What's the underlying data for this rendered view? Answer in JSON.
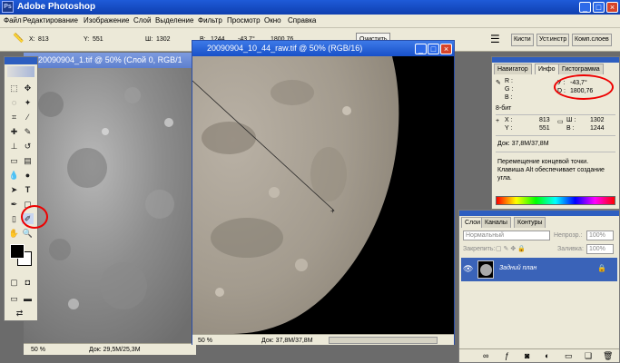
{
  "app": {
    "title": "Adobe Photoshop"
  },
  "window_controls": {
    "minimize": "_",
    "maximize": "□",
    "close": "×"
  },
  "menu": [
    "Файл",
    "Редактирование",
    "Изображение",
    "Слой",
    "Выделение",
    "Фильтр",
    "Просмотр",
    "Окно",
    "Справка"
  ],
  "options_bar": {
    "x_label": "X:",
    "x_value": "813",
    "y_label": "Y:",
    "y_value": "551",
    "w_label": "Ш:",
    "w_value": "1302",
    "h_label": "В:",
    "h_value": "1244",
    "angle_value": "-43,7°",
    "dist_value": "1800,76",
    "clear_button": "Очистить",
    "palette_tabs": [
      "Кисти",
      "Уст.инстр",
      "Комп.слоев"
    ]
  },
  "doc1": {
    "title": "20090904_1.tif @ 50% (Слой 0, RGB/1",
    "zoom": "50 %",
    "status": "Док: 29,5M/25,3M"
  },
  "doc2": {
    "title": "20090904_10_44_raw.tif @ 50% (RGB/16)",
    "zoom": "50 %",
    "status": "Док: 37,8M/37,8M"
  },
  "info_panel": {
    "tabs": [
      "Навигатор",
      "Инфо",
      "Гистограмма"
    ],
    "r_label": "R :",
    "g_label": "G :",
    "b_label": "B :",
    "a_label": "У :",
    "a_value": "-43,7°",
    "d_label": "D :",
    "d_value": "1800,76",
    "bit_mode": "8-бит",
    "x_label": "X :",
    "x_value": "813",
    "y_label": "Y :",
    "y_value": "551",
    "w_label": "Ш :",
    "w_value": "1302",
    "h_label": "В :",
    "h_value": "1244",
    "doc_size": "Док: 37,8M/37,8M",
    "hint_line1": "Перемещение концевой точки.",
    "hint_line2": "Клавиша Alt обеспечивает создание",
    "hint_line3": "угла."
  },
  "layers_panel": {
    "tabs": [
      "Слои",
      "Каналы",
      "Контуры"
    ],
    "blend_mode": "Нормальный",
    "opacity_label": "Непрозр.:",
    "opacity_value": "100%",
    "lock_label": "Закрепить:",
    "fill_label": "Заливка:",
    "fill_value": "100%",
    "layer_name": "Задний план"
  },
  "colors": {
    "title_bar": "#1f5bd8",
    "chrome": "#ece9d8",
    "workspace": "#6b6b6b",
    "highlight_ring": "#e00000",
    "layer_selected": "#3a63b8"
  }
}
